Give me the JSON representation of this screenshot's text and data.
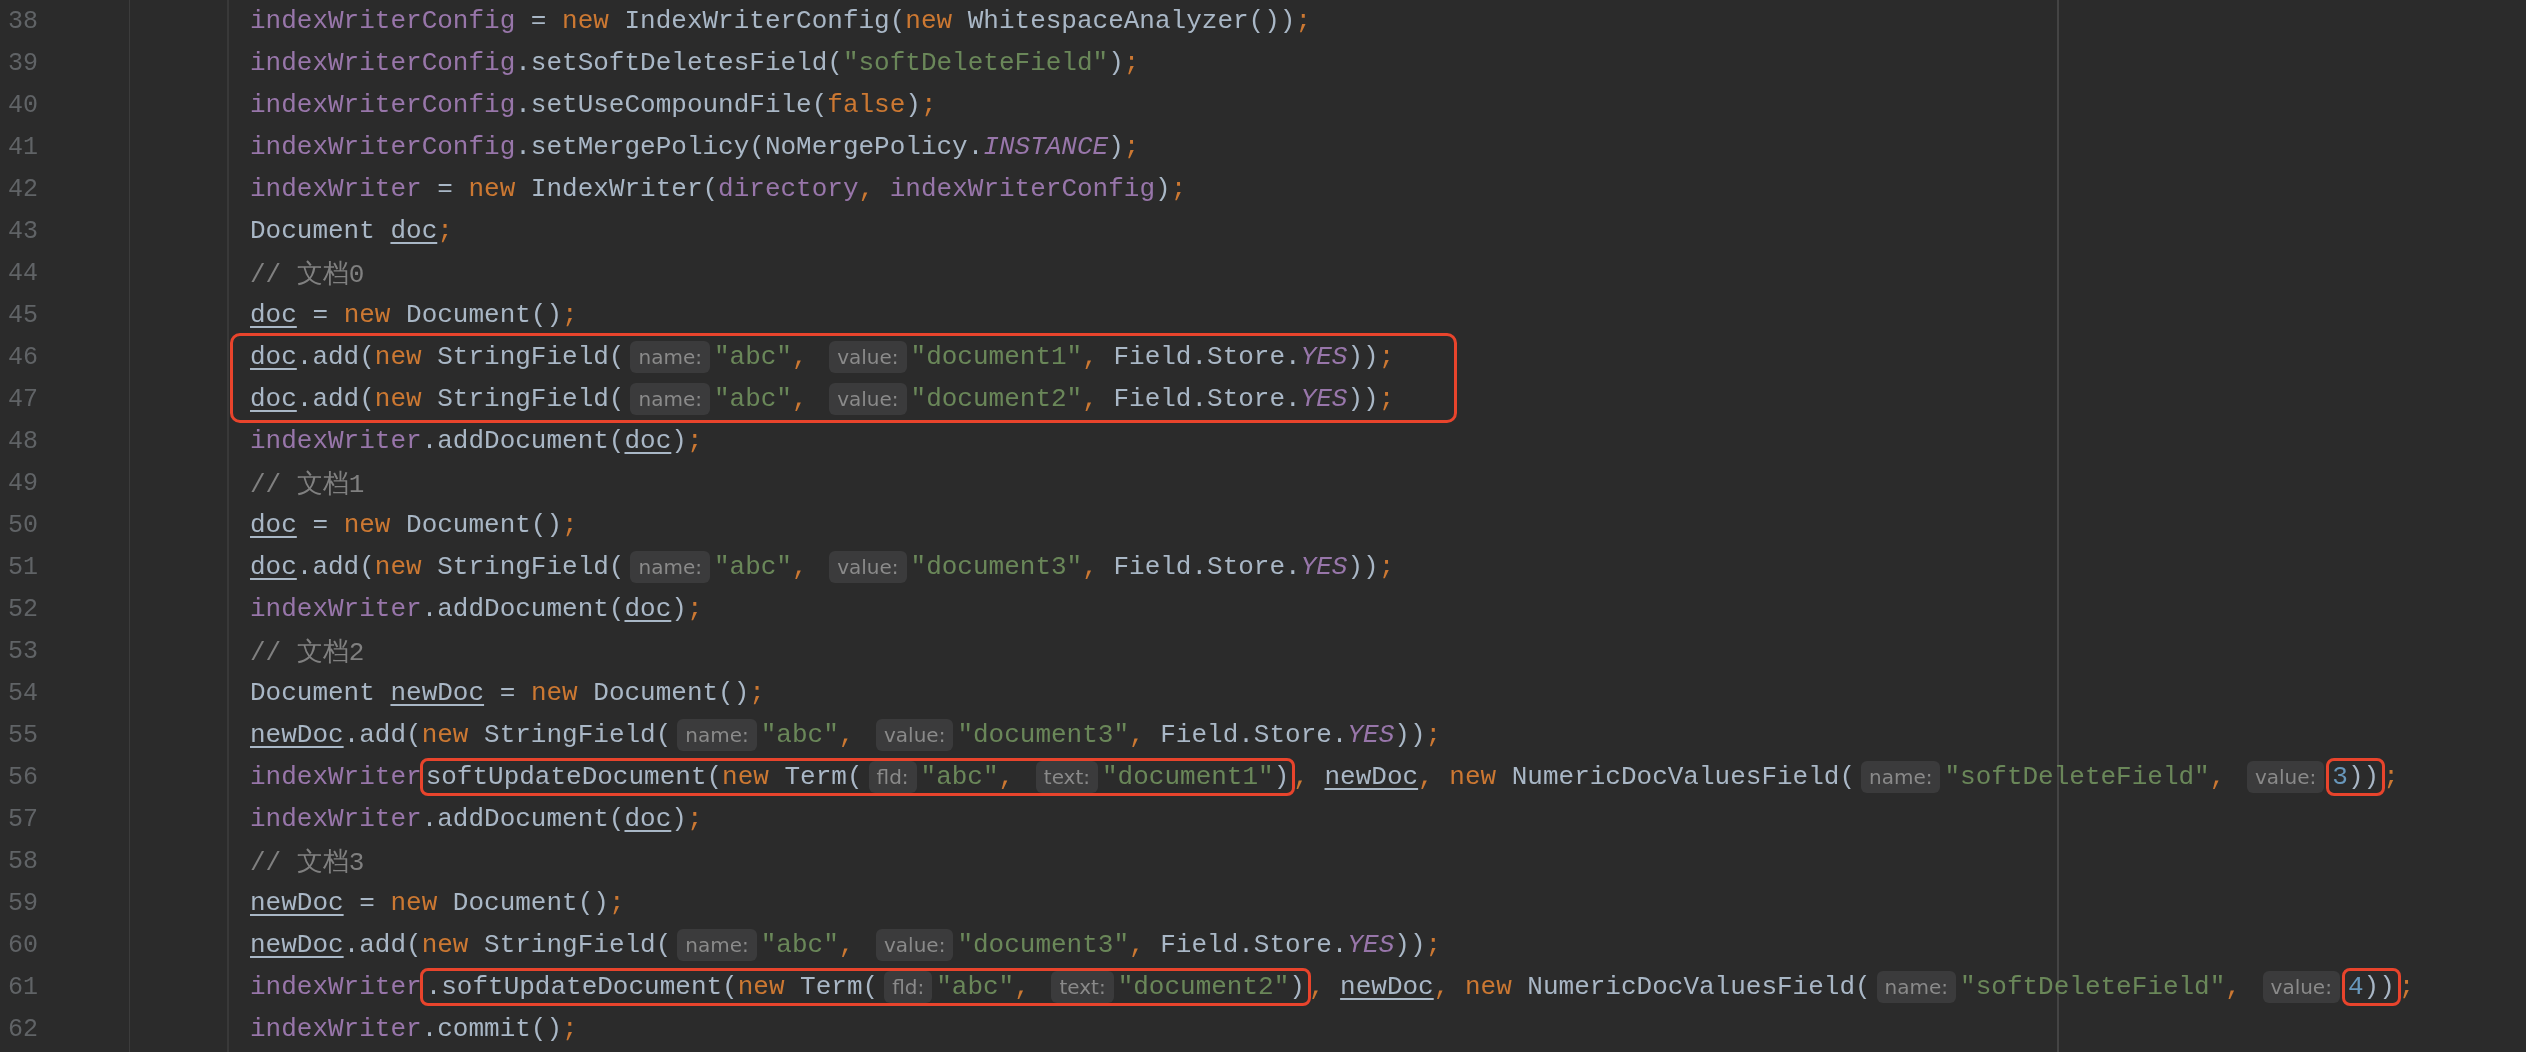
{
  "editor": {
    "lines": [
      {
        "number": "38",
        "tokens": [
          {
            "kind": "field",
            "text": "indexWriterConfig"
          },
          {
            "kind": "plain",
            "text": " = "
          },
          {
            "kind": "keyword",
            "text": "new"
          },
          {
            "kind": "plain",
            "text": " IndexWriterConfig("
          },
          {
            "kind": "keyword",
            "text": "new"
          },
          {
            "kind": "plain",
            "text": " WhitespaceAnalyzer())"
          },
          {
            "kind": "keyword",
            "text": ";"
          }
        ]
      },
      {
        "number": "39",
        "tokens": [
          {
            "kind": "field",
            "text": "indexWriterConfig"
          },
          {
            "kind": "plain",
            "text": ".setSoftDeletesField("
          },
          {
            "kind": "string",
            "text": "\"softDeleteField\""
          },
          {
            "kind": "plain",
            "text": ")"
          },
          {
            "kind": "keyword",
            "text": ";"
          }
        ]
      },
      {
        "number": "40",
        "tokens": [
          {
            "kind": "field",
            "text": "indexWriterConfig"
          },
          {
            "kind": "plain",
            "text": ".setUseCompoundFile("
          },
          {
            "kind": "keyword",
            "text": "false"
          },
          {
            "kind": "plain",
            "text": ")"
          },
          {
            "kind": "keyword",
            "text": ";"
          }
        ]
      },
      {
        "number": "41",
        "tokens": [
          {
            "kind": "field",
            "text": "indexWriterConfig"
          },
          {
            "kind": "plain",
            "text": ".setMergePolicy(NoMergePolicy."
          },
          {
            "kind": "constant",
            "text": "INSTANCE"
          },
          {
            "kind": "plain",
            "text": ")"
          },
          {
            "kind": "keyword",
            "text": ";"
          }
        ]
      },
      {
        "number": "42",
        "tokens": [
          {
            "kind": "field",
            "text": "indexWriter"
          },
          {
            "kind": "plain",
            "text": " = "
          },
          {
            "kind": "keyword",
            "text": "new"
          },
          {
            "kind": "plain",
            "text": " IndexWriter("
          },
          {
            "kind": "field",
            "text": "directory"
          },
          {
            "kind": "keyword",
            "text": ", "
          },
          {
            "kind": "field",
            "text": "indexWriterConfig"
          },
          {
            "kind": "plain",
            "text": ")"
          },
          {
            "kind": "keyword",
            "text": ";"
          }
        ]
      },
      {
        "number": "43",
        "tokens": [
          {
            "kind": "plain",
            "text": "Document "
          },
          {
            "kind": "variable",
            "text": "doc"
          },
          {
            "kind": "keyword",
            "text": ";"
          }
        ]
      },
      {
        "number": "44",
        "tokens": [
          {
            "kind": "comment",
            "text": "// 文档0"
          }
        ]
      },
      {
        "number": "45",
        "tokens": [
          {
            "kind": "variable",
            "text": "doc"
          },
          {
            "kind": "plain",
            "text": " = "
          },
          {
            "kind": "keyword",
            "text": "new"
          },
          {
            "kind": "plain",
            "text": " Document()"
          },
          {
            "kind": "keyword",
            "text": ";"
          }
        ]
      },
      {
        "kind": "highlight",
        "lines": [
          {
            "number": "46",
            "tokens": [
              {
                "kind": "variable",
                "text": "doc"
              },
              {
                "kind": "plain",
                "text": ".add("
              },
              {
                "kind": "keyword",
                "text": "new"
              },
              {
                "kind": "plain",
                "text": " StringField("
              },
              {
                "kind": "hint",
                "text": "name:"
              },
              {
                "kind": "string",
                "text": "\"abc\""
              },
              {
                "kind": "keyword",
                "text": ", "
              },
              {
                "kind": "hint",
                "text": "value:"
              },
              {
                "kind": "string",
                "text": "\"document1\""
              },
              {
                "kind": "keyword",
                "text": ", "
              },
              {
                "kind": "plain",
                "text": "Field.Store."
              },
              {
                "kind": "constant",
                "text": "YES"
              },
              {
                "kind": "plain",
                "text": "))"
              },
              {
                "kind": "keyword",
                "text": ";"
              }
            ]
          },
          {
            "number": "47",
            "tokens": [
              {
                "kind": "variable",
                "text": "doc"
              },
              {
                "kind": "plain",
                "text": ".add("
              },
              {
                "kind": "keyword",
                "text": "new"
              },
              {
                "kind": "plain",
                "text": " StringField("
              },
              {
                "kind": "hint",
                "text": "name:"
              },
              {
                "kind": "string",
                "text": "\"abc\""
              },
              {
                "kind": "keyword",
                "text": ", "
              },
              {
                "kind": "hint",
                "text": "value:"
              },
              {
                "kind": "string",
                "text": "\"document2\""
              },
              {
                "kind": "keyword",
                "text": ", "
              },
              {
                "kind": "plain",
                "text": "Field.Store."
              },
              {
                "kind": "constant",
                "text": "YES"
              },
              {
                "kind": "plain",
                "text": "))"
              },
              {
                "kind": "keyword",
                "text": ";"
              }
            ]
          }
        ]
      },
      {
        "number": "48",
        "tokens": [
          {
            "kind": "field",
            "text": "indexWriter"
          },
          {
            "kind": "plain",
            "text": ".addDocument("
          },
          {
            "kind": "variable",
            "text": "doc"
          },
          {
            "kind": "plain",
            "text": ")"
          },
          {
            "kind": "keyword",
            "text": ";"
          }
        ]
      },
      {
        "number": "49",
        "tokens": [
          {
            "kind": "comment",
            "text": "// 文档1"
          }
        ]
      },
      {
        "number": "50",
        "tokens": [
          {
            "kind": "variable",
            "text": "doc"
          },
          {
            "kind": "plain",
            "text": " = "
          },
          {
            "kind": "keyword",
            "text": "new"
          },
          {
            "kind": "plain",
            "text": " Document()"
          },
          {
            "kind": "keyword",
            "text": ";"
          }
        ]
      },
      {
        "number": "51",
        "tokens": [
          {
            "kind": "variable",
            "text": "doc"
          },
          {
            "kind": "plain",
            "text": ".add("
          },
          {
            "kind": "keyword",
            "text": "new"
          },
          {
            "kind": "plain",
            "text": " StringField("
          },
          {
            "kind": "hint",
            "text": "name:"
          },
          {
            "kind": "string",
            "text": "\"abc\""
          },
          {
            "kind": "keyword",
            "text": ", "
          },
          {
            "kind": "hint",
            "text": "value:"
          },
          {
            "kind": "string",
            "text": "\"document3\""
          },
          {
            "kind": "keyword",
            "text": ", "
          },
          {
            "kind": "plain",
            "text": "Field.Store."
          },
          {
            "kind": "constant",
            "text": "YES"
          },
          {
            "kind": "plain",
            "text": "))"
          },
          {
            "kind": "keyword",
            "text": ";"
          }
        ]
      },
      {
        "number": "52",
        "tokens": [
          {
            "kind": "field",
            "text": "indexWriter"
          },
          {
            "kind": "plain",
            "text": ".addDocument("
          },
          {
            "kind": "variable",
            "text": "doc"
          },
          {
            "kind": "plain",
            "text": ")"
          },
          {
            "kind": "keyword",
            "text": ";"
          }
        ]
      },
      {
        "number": "53",
        "tokens": [
          {
            "kind": "comment",
            "text": "// 文档2"
          }
        ]
      },
      {
        "number": "54",
        "tokens": [
          {
            "kind": "plain",
            "text": "Document "
          },
          {
            "kind": "variable",
            "text": "newDoc"
          },
          {
            "kind": "plain",
            "text": " = "
          },
          {
            "kind": "keyword",
            "text": "new"
          },
          {
            "kind": "plain",
            "text": " Document()"
          },
          {
            "kind": "keyword",
            "text": ";"
          }
        ]
      },
      {
        "number": "55",
        "tokens": [
          {
            "kind": "variable",
            "text": "newDoc"
          },
          {
            "kind": "plain",
            "text": ".add("
          },
          {
            "kind": "keyword",
            "text": "new"
          },
          {
            "kind": "plain",
            "text": " StringField("
          },
          {
            "kind": "hint",
            "text": "name:"
          },
          {
            "kind": "string",
            "text": "\"abc\""
          },
          {
            "kind": "keyword",
            "text": ", "
          },
          {
            "kind": "hint",
            "text": "value:"
          },
          {
            "kind": "string",
            "text": "\"document3\""
          },
          {
            "kind": "keyword",
            "text": ", "
          },
          {
            "kind": "plain",
            "text": "Field.Store."
          },
          {
            "kind": "constant",
            "text": "YES"
          },
          {
            "kind": "plain",
            "text": "))"
          },
          {
            "kind": "keyword",
            "text": ";"
          }
        ]
      },
      {
        "number": "56",
        "tokens": [
          {
            "kind": "field",
            "text": "indexWriter"
          },
          {
            "kind": "box",
            "tokens": [
              {
                "kind": "plain",
                "text": "softUpdateDocument("
              },
              {
                "kind": "keyword",
                "text": "new"
              },
              {
                "kind": "plain",
                "text": " Term("
              },
              {
                "kind": "hint",
                "text": "fld:"
              },
              {
                "kind": "string",
                "text": "\"abc\""
              },
              {
                "kind": "keyword",
                "text": ", "
              },
              {
                "kind": "hint",
                "text": "text:"
              },
              {
                "kind": "string",
                "text": "\"document1\""
              },
              {
                "kind": "plain",
                "text": ")"
              }
            ]
          },
          {
            "kind": "keyword",
            "text": ", "
          },
          {
            "kind": "variable",
            "text": "newDoc"
          },
          {
            "kind": "keyword",
            "text": ", "
          },
          {
            "kind": "keyword",
            "text": "new"
          },
          {
            "kind": "plain",
            "text": " NumericDocValuesField("
          },
          {
            "kind": "hint",
            "text": "name:"
          },
          {
            "kind": "string",
            "text": "\"softDeleteField\""
          },
          {
            "kind": "keyword",
            "text": ", "
          },
          {
            "kind": "hint",
            "text": "value:"
          },
          {
            "kind": "box",
            "tokens": [
              {
                "kind": "number",
                "text": "3"
              },
              {
                "kind": "plain",
                "text": "))"
              }
            ]
          },
          {
            "kind": "keyword",
            "text": ";"
          }
        ]
      },
      {
        "number": "57",
        "tokens": [
          {
            "kind": "field",
            "text": "indexWriter"
          },
          {
            "kind": "plain",
            "text": ".addDocument("
          },
          {
            "kind": "variable",
            "text": "doc"
          },
          {
            "kind": "plain",
            "text": ")"
          },
          {
            "kind": "keyword",
            "text": ";"
          }
        ]
      },
      {
        "number": "58",
        "tokens": [
          {
            "kind": "comment",
            "text": "// 文档3"
          }
        ]
      },
      {
        "number": "59",
        "tokens": [
          {
            "kind": "variable",
            "text": "newDoc"
          },
          {
            "kind": "plain",
            "text": " = "
          },
          {
            "kind": "keyword",
            "text": "new"
          },
          {
            "kind": "plain",
            "text": " Document()"
          },
          {
            "kind": "keyword",
            "text": ";"
          }
        ]
      },
      {
        "number": "60",
        "tokens": [
          {
            "kind": "variable",
            "text": "newDoc"
          },
          {
            "kind": "plain",
            "text": ".add("
          },
          {
            "kind": "keyword",
            "text": "new"
          },
          {
            "kind": "plain",
            "text": " StringField("
          },
          {
            "kind": "hint",
            "text": "name:"
          },
          {
            "kind": "string",
            "text": "\"abc\""
          },
          {
            "kind": "keyword",
            "text": ", "
          },
          {
            "kind": "hint",
            "text": "value:"
          },
          {
            "kind": "string",
            "text": "\"document3\""
          },
          {
            "kind": "keyword",
            "text": ", "
          },
          {
            "kind": "plain",
            "text": "Field.Store."
          },
          {
            "kind": "constant",
            "text": "YES"
          },
          {
            "kind": "plain",
            "text": "))"
          },
          {
            "kind": "keyword",
            "text": ";"
          }
        ]
      },
      {
        "number": "61",
        "tokens": [
          {
            "kind": "field",
            "text": "indexWriter"
          },
          {
            "kind": "box",
            "tokens": [
              {
                "kind": "plain",
                "text": ".softUpdateDocument("
              },
              {
                "kind": "keyword",
                "text": "new"
              },
              {
                "kind": "plain",
                "text": " Term("
              },
              {
                "kind": "hint",
                "text": "fld:"
              },
              {
                "kind": "string",
                "text": "\"abc\""
              },
              {
                "kind": "keyword",
                "text": ", "
              },
              {
                "kind": "hint",
                "text": "text:"
              },
              {
                "kind": "string",
                "text": "\"document2\""
              },
              {
                "kind": "plain",
                "text": ")"
              }
            ]
          },
          {
            "kind": "keyword",
            "text": ", "
          },
          {
            "kind": "variable",
            "text": "newDoc"
          },
          {
            "kind": "keyword",
            "text": ", "
          },
          {
            "kind": "keyword",
            "text": "new"
          },
          {
            "kind": "plain",
            "text": " NumericDocValuesField("
          },
          {
            "kind": "hint",
            "text": "name:"
          },
          {
            "kind": "string",
            "text": "\"softDeleteField\""
          },
          {
            "kind": "keyword",
            "text": ", "
          },
          {
            "kind": "hint",
            "text": "value:"
          },
          {
            "kind": "box",
            "tokens": [
              {
                "kind": "number",
                "text": "4"
              },
              {
                "kind": "plain",
                "text": "))"
              }
            ]
          },
          {
            "kind": "keyword",
            "text": ";"
          }
        ]
      },
      {
        "number": "62",
        "tokens": [
          {
            "kind": "field",
            "text": "indexWriter"
          },
          {
            "kind": "plain",
            "text": ".commit()"
          },
          {
            "kind": "keyword",
            "text": ";"
          }
        ]
      }
    ]
  }
}
